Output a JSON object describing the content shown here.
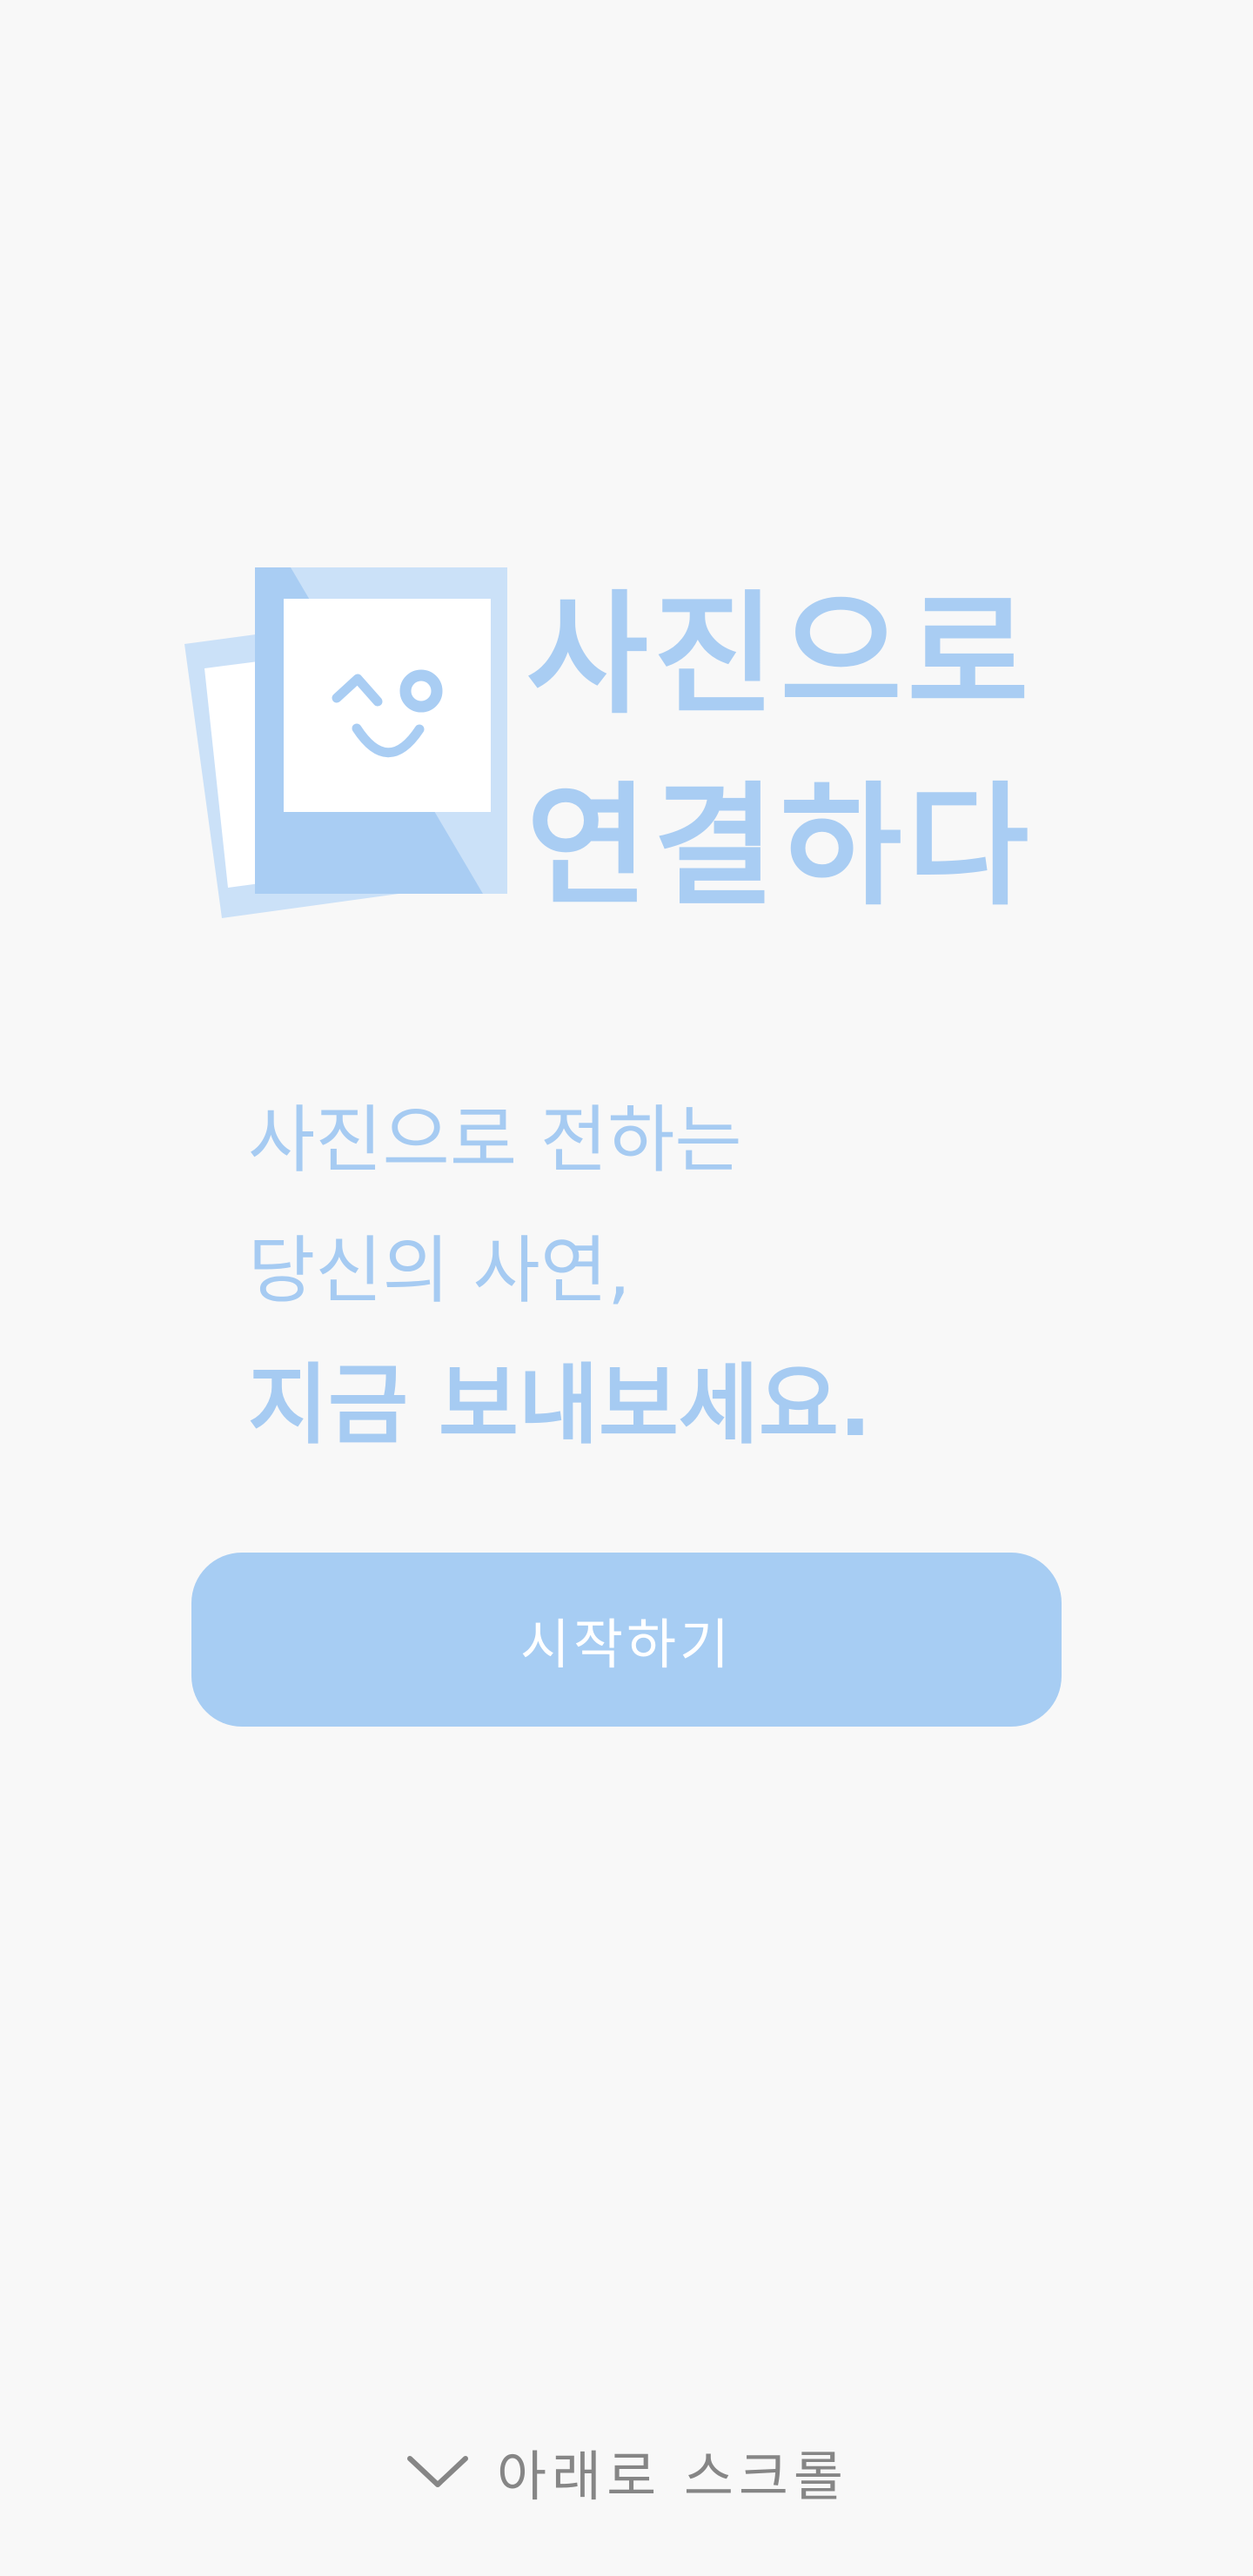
{
  "logo": {
    "title_line1": "사진으로",
    "title_line2": "연결하다",
    "icon": "smiling-photo-icon",
    "colors": {
      "back_photo": "#cbe1f8",
      "front_photo": "#a9cdf3",
      "face": "#a9cdf3"
    }
  },
  "message": {
    "line1": "사진으로 전하는",
    "line2": "당신의 사연,",
    "line3": "지금 보내보세요."
  },
  "start_button": {
    "label": "시작하기",
    "color": "#a7cdf3"
  },
  "scroll_hint": {
    "label": "아래로 스크롤",
    "icon": "chevron-down-icon"
  }
}
